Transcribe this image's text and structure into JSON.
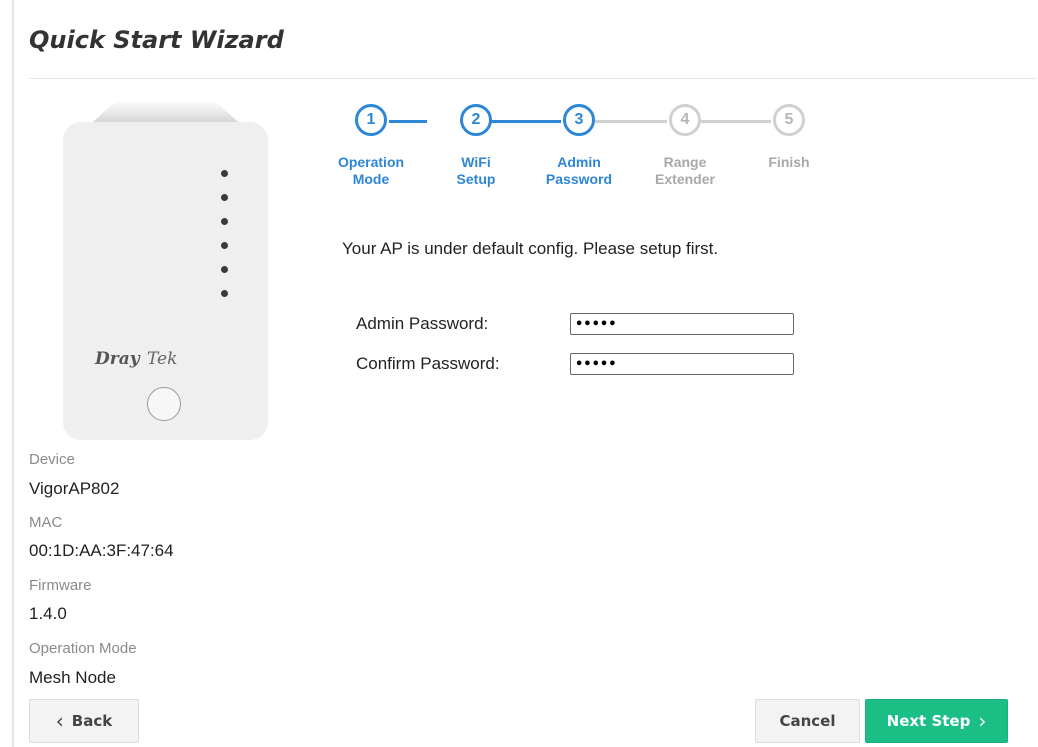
{
  "title": "Quick Start Wizard",
  "device_image": {
    "logo_primary": "Dray",
    "logo_secondary": "Tek"
  },
  "info": [
    {
      "label": "Device",
      "value": "VigorAP802"
    },
    {
      "label": "MAC",
      "value": "00:1D:AA:3F:47:64"
    },
    {
      "label": "Firmware",
      "value": "1.4.0"
    },
    {
      "label": "Operation Mode",
      "value": "Mesh Node"
    }
  ],
  "steps": [
    {
      "number": "1",
      "line1": "Operation",
      "line2": "Mode",
      "state": "complete"
    },
    {
      "number": "2",
      "line1": "WiFi",
      "line2": "Setup",
      "state": "complete"
    },
    {
      "number": "3",
      "line1": "Admin",
      "line2": "Password",
      "state": "current"
    },
    {
      "number": "4",
      "line1": "Range",
      "line2": "Extender",
      "state": "pending"
    },
    {
      "number": "5",
      "line1": "Finish",
      "line2": "",
      "state": "pending"
    }
  ],
  "message": "Your AP is under default config. Please setup first.",
  "form": {
    "admin_password_label": "Admin Password:",
    "admin_password_value": "•••••",
    "confirm_password_label": "Confirm Password:",
    "confirm_password_value": "•••••"
  },
  "buttons": {
    "back": "Back",
    "cancel": "Cancel",
    "next": "Next Step"
  },
  "icons": {
    "back": "chevron-left-icon",
    "next": "chevron-right-icon"
  },
  "colors": {
    "accent": "#2d86d6",
    "primary_button": "#1bbf86",
    "inactive": "#d0d0d0"
  }
}
